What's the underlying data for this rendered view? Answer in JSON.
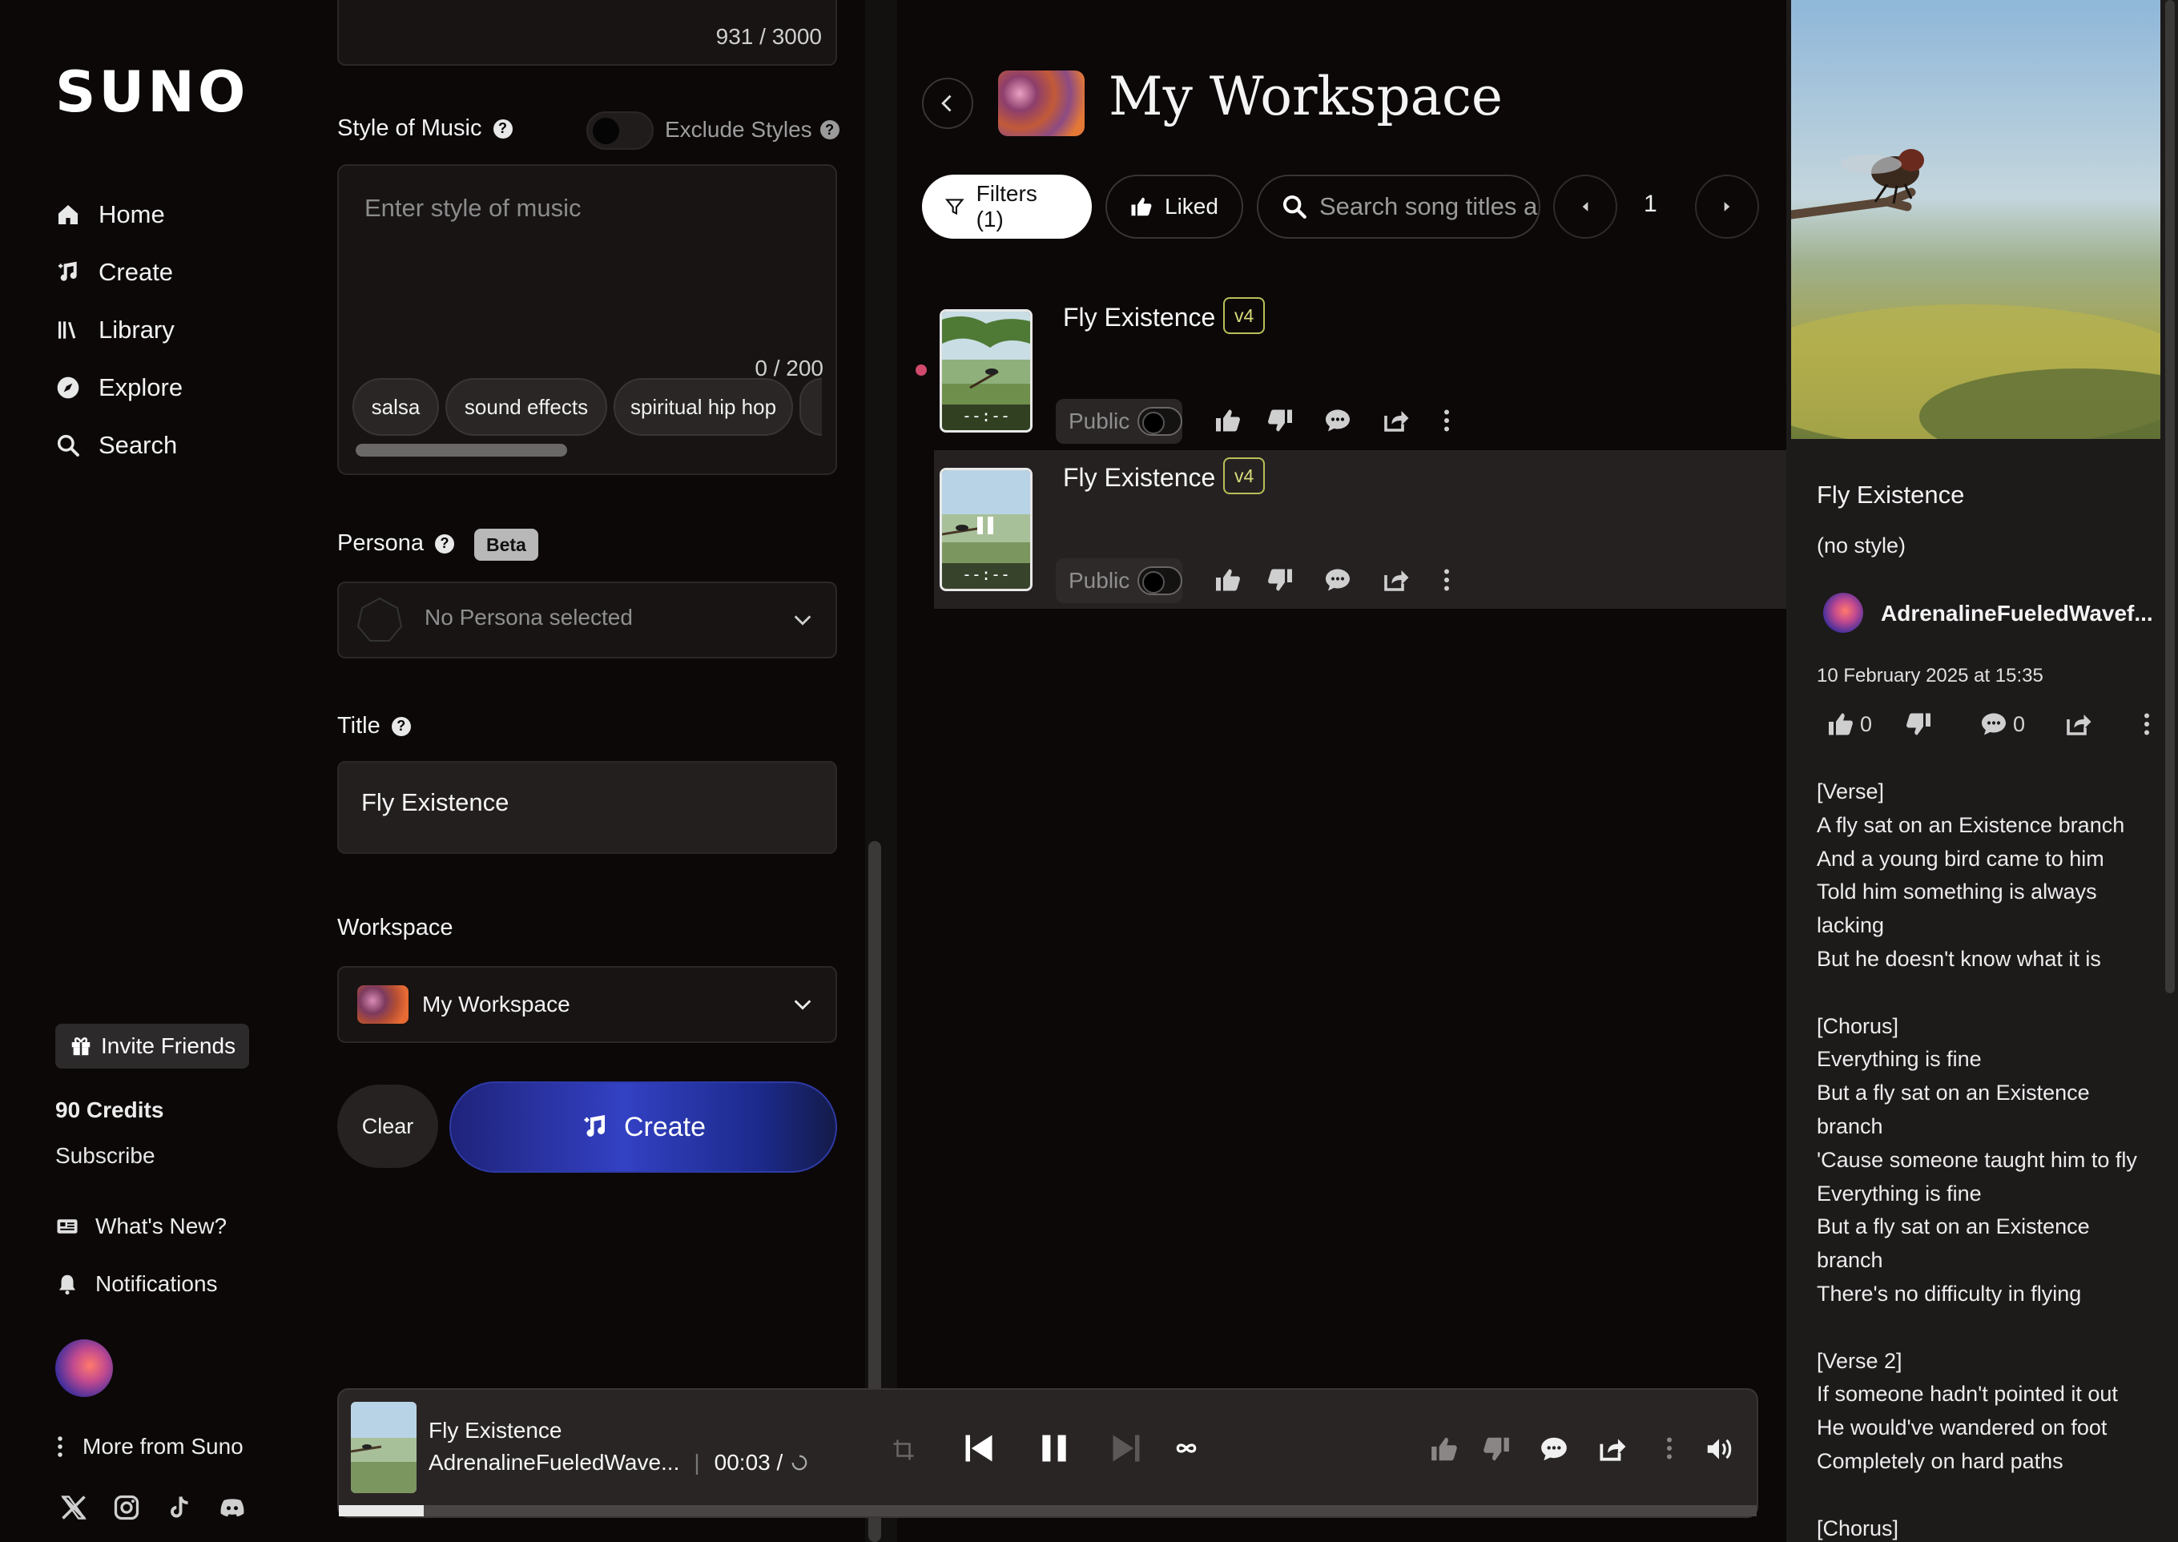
{
  "app": {
    "logo": "SUNO"
  },
  "sidebar": {
    "nav": [
      {
        "label": "Home",
        "icon": "home-icon"
      },
      {
        "label": "Create",
        "icon": "music-note-icon"
      },
      {
        "label": "Library",
        "icon": "library-icon"
      },
      {
        "label": "Explore",
        "icon": "compass-icon"
      },
      {
        "label": "Search",
        "icon": "search-icon"
      }
    ],
    "invite_label": "Invite Friends",
    "credits": "90 Credits",
    "subscribe": "Subscribe",
    "whats_new": "What's New?",
    "notifications": "Notifications",
    "more": "More from Suno"
  },
  "create": {
    "lyrics_count": "931 / 3000",
    "style_label": "Style of Music",
    "exclude_label": "Exclude Styles",
    "style_placeholder": "Enter style of music",
    "style_count": "0 / 200",
    "chips": [
      "salsa",
      "sound effects",
      "spiritual hip hop"
    ],
    "persona_label": "Persona",
    "beta": "Beta",
    "persona_value": "No Persona selected",
    "title_label": "Title",
    "title_value": "Fly Existence",
    "workspace_label": "Workspace",
    "workspace_value": "My Workspace",
    "clear": "Clear",
    "create": "Create"
  },
  "workspace": {
    "title": "My Workspace",
    "filters": "Filters (1)",
    "liked": "Liked",
    "search_placeholder": "Search song titles and styles",
    "page": "1",
    "songs": [
      {
        "title": "Fly Existence",
        "version": "v4",
        "visibility": "Public",
        "duration": "--:--"
      },
      {
        "title": "Fly Existence",
        "version": "v4",
        "visibility": "Public",
        "duration": "--:--"
      }
    ]
  },
  "detail": {
    "title": "Fly Existence",
    "style": "(no style)",
    "user": "AdrenalineFueledWavef...",
    "date": "10 February 2025 at 15:35",
    "likes": "0",
    "comments": "0",
    "lyrics": [
      "[Verse]",
      "A fly sat on an Existence branch",
      "And a young bird came to him",
      "Told him something is always",
      "lacking",
      "But he doesn't know what it is",
      "",
      "[Chorus]",
      "Everything is fine",
      "But a fly sat on an Existence",
      "branch",
      "'Cause someone taught him to fly",
      "Everything is fine",
      "But a fly sat on an Existence",
      "branch",
      "There's no difficulty in flying",
      "",
      "[Verse 2]",
      "If someone hadn't pointed it out",
      "He would've wandered on foot",
      "Completely on hard paths",
      "",
      "[Chorus]"
    ]
  },
  "player": {
    "title": "Fly Existence",
    "artist": "AdrenalineFueledWave...",
    "time": "00:03 /",
    "progress": 0.06
  }
}
